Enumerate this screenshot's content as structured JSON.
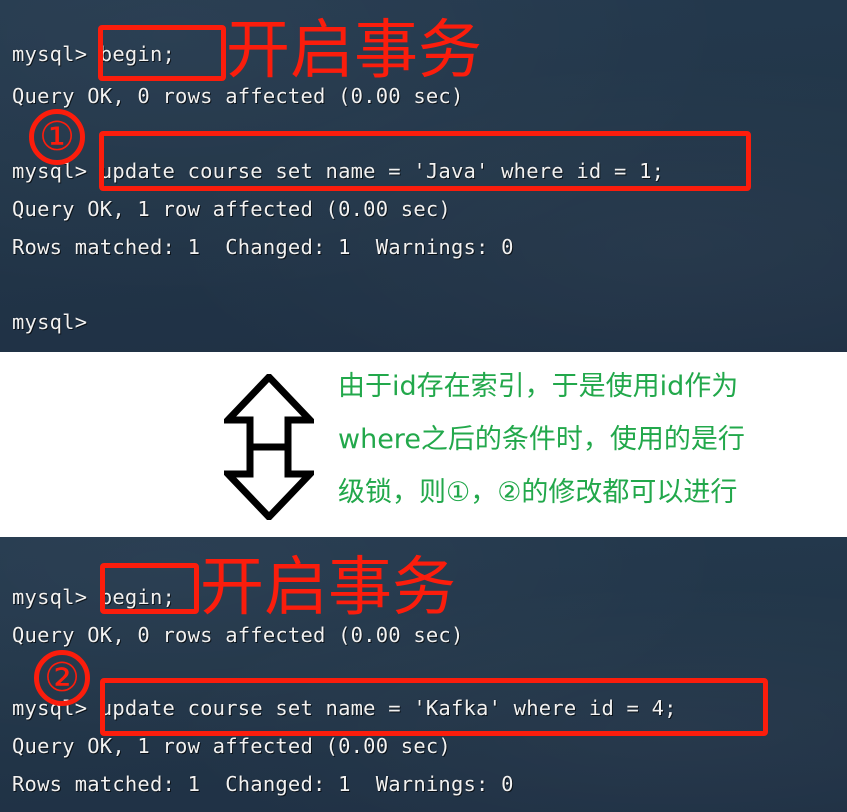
{
  "colors": {
    "terminal_background": "#223649",
    "terminal_text": "#f2f2f2",
    "annotation_red": "#fb1d0c",
    "explanation_green": "#22a84b",
    "band_background": "#ffffff"
  },
  "top_terminal": {
    "name": "mysql-session-transaction-one",
    "lines": [
      {
        "id": "t1",
        "text": "mysql> begin;"
      },
      {
        "id": "t2",
        "text": "Query OK, 0 rows affected (0.00 sec)"
      },
      {
        "id": "t3",
        "text": "mysql> update course set name = 'Java' where id = 1;"
      },
      {
        "id": "t4",
        "text": "Query OK, 1 row affected (0.00 sec)"
      },
      {
        "id": "t5",
        "text": "Rows matched: 1  Changed: 1  Warnings: 0"
      },
      {
        "id": "t6",
        "text": "mysql>"
      }
    ],
    "annotations": {
      "begin_label": "开启事务",
      "marker": "①",
      "highlighted_begin": "begin;",
      "highlighted_statement": "update course set name = 'Java' where id = 1;"
    }
  },
  "explanation": {
    "arrow_icon": "double-headed-vertical-arrow",
    "lines": [
      "由于id存在索引，于是使用id作为",
      "where之后的条件时，使用的是行",
      "级锁，则①，②的修改都可以进行"
    ]
  },
  "bottom_terminal": {
    "name": "mysql-session-transaction-two",
    "lines": [
      {
        "id": "b1",
        "text": "mysql> begin;"
      },
      {
        "id": "b2",
        "text": "Query OK, 0 rows affected (0.00 sec)"
      },
      {
        "id": "b3",
        "text": "mysql> update course set name = 'Kafka' where id = 4;"
      },
      {
        "id": "b4",
        "text": "Query OK, 1 row affected (0.00 sec)"
      },
      {
        "id": "b5",
        "text": "Rows matched: 1  Changed: 1  Warnings: 0"
      }
    ],
    "annotations": {
      "begin_label": "开启事务",
      "marker": "②",
      "highlighted_begin": "begin;",
      "highlighted_statement": "update course set name = 'Kafka' where id = 4;"
    }
  }
}
